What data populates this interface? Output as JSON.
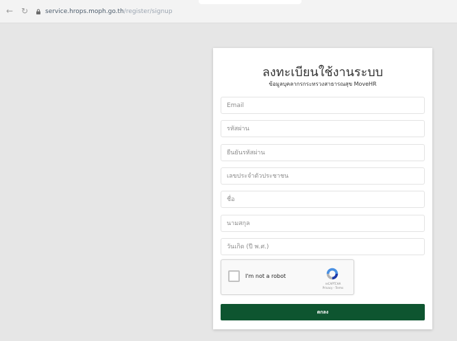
{
  "browser": {
    "back_icon": "←",
    "reload_icon": "↻",
    "url": "service.hrops.moph.go.th",
    "url_path": "/register/signup"
  },
  "card": {
    "title": "ลงทะเบียนใช้งานระบบ",
    "subtitle": "ข้อมูลบุคลากรกระทรวงสาธารณสุข MoveHR"
  },
  "fields": {
    "email": "Email",
    "password": "รหัสผ่าน",
    "confirm_password": "ยืนยันรหัสผ่าน",
    "id_card": "เลขประจำตัวประชาชน",
    "first_name": "ชื่อ",
    "last_name": "นามสกุล",
    "birthdate": "วันเกิด (ปี พ.ศ.)"
  },
  "recaptcha": {
    "label": "I'm not a robot",
    "brand_line1": "reCAPTCHA",
    "brand_line2": "Privacy - Terms"
  },
  "submit": {
    "label": "ตกลง"
  },
  "colors": {
    "submit_bg": "#0e5530",
    "page_bg": "#e6e6e6"
  }
}
